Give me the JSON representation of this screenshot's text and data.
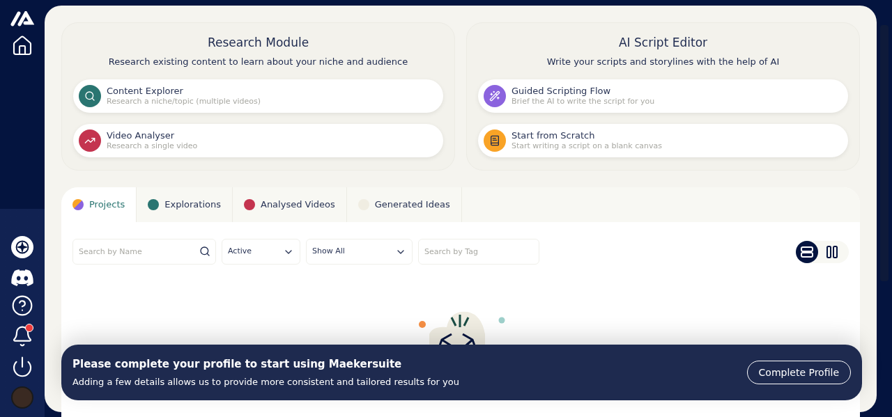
{
  "sidebar": {
    "notification_badge": true
  },
  "modules": [
    {
      "title": "Research Module",
      "subtitle": "Research existing content to learn about your niche and audience",
      "items": [
        {
          "kind": "search",
          "title": "Content Explorer",
          "subtitle": "Research a niche/topic (multiple videos)",
          "color": "#2a7571"
        },
        {
          "kind": "chart",
          "title": "Video Analyser",
          "subtitle": "Research a single video",
          "color": "#c4344f"
        }
      ]
    },
    {
      "title": "AI Script Editor",
      "subtitle": "Write your scripts and storylines with the help of AI",
      "items": [
        {
          "kind": "wand",
          "title": "Guided Scripting Flow",
          "subtitle": "Brief the AI to write the script for you",
          "color": "#8b63de"
        },
        {
          "kind": "page",
          "title": "Start from Scratch",
          "subtitle": "Start writing a script on a blank canvas",
          "color": "#f9a326"
        }
      ]
    }
  ],
  "tabs": [
    {
      "label": "Projects",
      "selected": true,
      "kind": "split"
    },
    {
      "label": "Explorations",
      "selected": false,
      "kind": "dot",
      "color": "#2a7571"
    },
    {
      "label": "Analysed Videos",
      "selected": false,
      "kind": "dot",
      "color": "#c4344f"
    },
    {
      "label": "Generated Ideas",
      "selected": false,
      "kind": "dot",
      "color": "#f0ede2"
    }
  ],
  "filters": {
    "name_search": {
      "placeholder": "Search by Name"
    },
    "status": {
      "value": "Active"
    },
    "show": {
      "value": "Show All"
    },
    "tag_search": {
      "placeholder": "Search by Tag"
    }
  },
  "view_toggle": [
    {
      "kind": "rows",
      "selected": true
    },
    {
      "kind": "columns",
      "selected": false
    }
  ],
  "banner": {
    "title": "Please complete your profile to start using Maekersuite",
    "text": "Adding a few details allows us to provide more consistent and tailored results for you",
    "button": "Complete Profile"
  }
}
